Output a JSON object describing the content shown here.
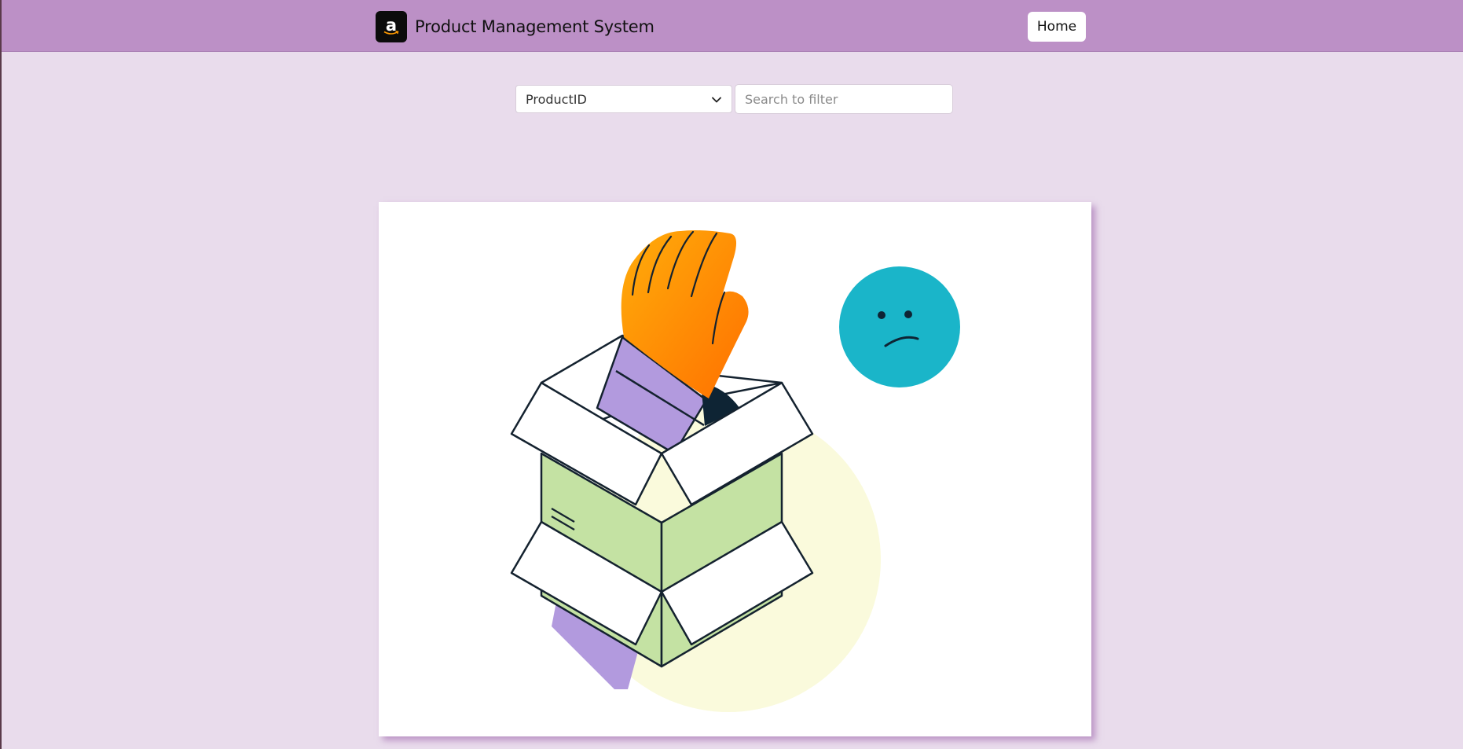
{
  "navbar": {
    "logo_letter": "a",
    "title": "Product Management System",
    "home_label": "Home"
  },
  "filters": {
    "field_selected": "ProductID",
    "search_placeholder": "Search to filter"
  },
  "empty_state": {
    "illustration": "empty-box-with-hand-and-sad-face"
  },
  "colors": {
    "navbar": "#bc90c6",
    "page_background": "#e9dcec",
    "sad_face": "#1ab5c9",
    "box_green": "#c4e2a3",
    "sleeve_purple": "#b29ade",
    "hand_orange": "#ff8c00",
    "blob_yellow": "#fafadc"
  }
}
